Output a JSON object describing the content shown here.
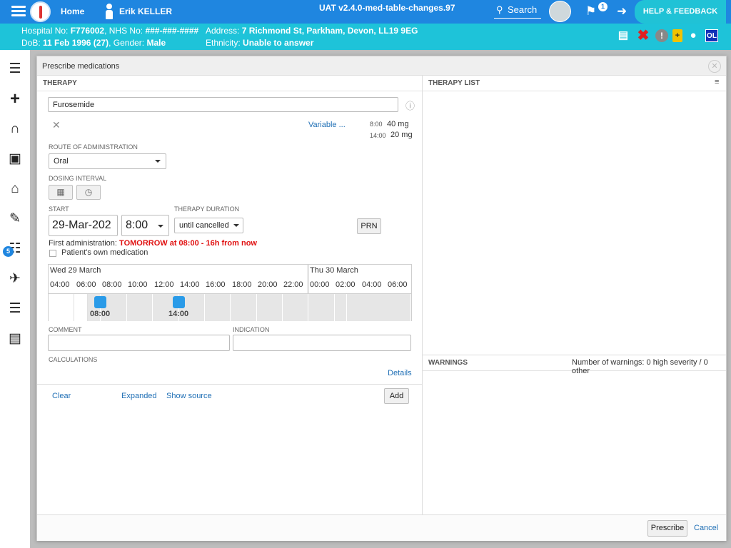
{
  "topbar": {
    "home": "Home",
    "user": "Erik KELLER",
    "env": "UAT v2.4.0-med-table-changes.97",
    "search": "Search",
    "flag_count": "1",
    "help": "HELP & FEEDBACK"
  },
  "patient": {
    "hospital_label": "Hospital No:",
    "hospital_no": "F776002",
    "nhs_label": "NHS No:",
    "nhs_no": "###-###-####",
    "address_label": "Address:",
    "address": "7 Richmond St, Parkham, Devon, LL19 9EG",
    "dob_label": "DoB:",
    "dob": "11 Feb 1996 (27)",
    "gender_label": "Gender:",
    "gender": "Male",
    "ethnicity_label": "Ethnicity:",
    "ethnicity": "Unable to answer",
    "icons": [
      "bed-icon",
      "x-icon",
      "alert-icon",
      "document-icon",
      "pill-icon",
      "ol-badge"
    ],
    "ol": "OL"
  },
  "nav": {
    "badge": "5",
    "items": [
      "list-icon",
      "plus-icon",
      "stethoscope-icon",
      "camera-icon",
      "home-icon",
      "edit-document-icon",
      "clipboard-icon",
      "running-icon",
      "checklist-icon",
      "ecg-icon"
    ]
  },
  "modal": {
    "title": "Prescribe medications",
    "therapy_header": "THERAPY",
    "therapy_list_header": "THERAPY LIST",
    "warnings_header": "WARNINGS",
    "warnings_count": "Number of warnings: 0 high severity / 0 other",
    "medication": "Furosemide",
    "variable_link": "Variable ...",
    "doses": [
      {
        "time": "8:00",
        "amount": "40 mg"
      },
      {
        "time": "14:00",
        "amount": "20 mg"
      }
    ],
    "route_label": "ROUTE OF ADMINISTRATION",
    "route_value": "Oral",
    "dosing_label": "DOSING INTERVAL",
    "start_label": "START",
    "start_date": "29-Mar-202",
    "start_time": "8:00",
    "duration_label": "THERAPY DURATION",
    "duration_value": "until cancelled",
    "prn": "PRN",
    "first_admin_label": "First administration:",
    "first_admin_value": "TOMORROW at 08:00 - 16h from now",
    "own_medication": "Patient's own medication",
    "schedule": {
      "day1": "Wed 29 March",
      "day2": "Thu 30 March",
      "hours": [
        "04:00",
        "06:00",
        "08:00",
        "10:00",
        "12:00",
        "14:00",
        "16:00",
        "18:00",
        "20:00",
        "22:00",
        "00:00",
        "02:00",
        "04:00",
        "06:00"
      ],
      "dose_times": [
        "08:00",
        "14:00"
      ]
    },
    "comment_label": "COMMENT",
    "indication_label": "INDICATION",
    "calculations_label": "CALCULATIONS",
    "details": "Details",
    "clear": "Clear",
    "expanded": "Expanded",
    "show_source": "Show source",
    "add": "Add",
    "prescribe": "Prescribe",
    "cancel": "Cancel"
  }
}
